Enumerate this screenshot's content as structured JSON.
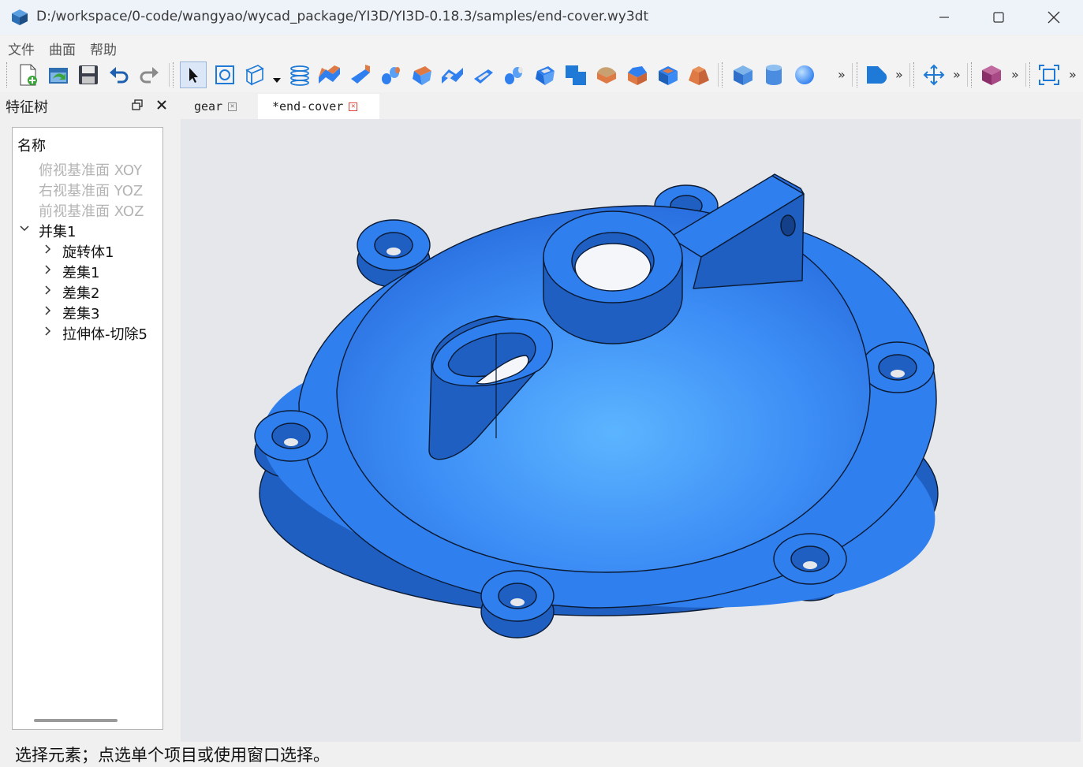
{
  "window": {
    "title": "D:/workspace/0-code/wangyao/wycad_package/YI3D/YI3D-0.18.3/samples/end-cover.wy3dt",
    "app_icon": "cube-app-icon",
    "controls": [
      "minimize-icon",
      "maximize-icon",
      "close-icon"
    ]
  },
  "menubar": {
    "items": [
      "文件",
      "曲面",
      "帮助"
    ]
  },
  "toolbar": {
    "more_glyph": "»",
    "groups": [
      [
        "new-document-icon",
        "open-document-icon",
        "save-icon",
        "undo-icon",
        "redo-icon"
      ],
      [
        "select-pointer-icon",
        "sketch-icon",
        "plane-icon",
        "dropdown-arrow-icon",
        "helix-icon",
        "extrude-icon",
        "revolve-icon",
        "sweep-icon",
        "loft-icon",
        "extrude-cut-icon",
        "revolve-cut-icon",
        "sweep-cut-icon",
        "loft-cut-icon",
        "boolean-icon",
        "fillet-icon",
        "chamfer-icon",
        "shell-icon",
        "draft-icon"
      ],
      [
        "box-icon",
        "cylinder-icon",
        "sphere-icon"
      ],
      [
        "shape-icon"
      ],
      [
        "move-icon"
      ],
      [
        "solid-icon"
      ],
      [
        "fit-view-icon"
      ]
    ]
  },
  "feature_tree": {
    "title": "特征树",
    "header": "名称",
    "planes": [
      "俯视基准面 XOY",
      "右视基准面 YOZ",
      "前视基准面 XOZ"
    ],
    "root": "并集1",
    "children": [
      "旋转体1",
      "差集1",
      "差集2",
      "差集3",
      "拉伸体-切除5"
    ]
  },
  "tabs": [
    {
      "label": "gear",
      "active": false
    },
    {
      "label": "*end-cover",
      "active": true
    }
  ],
  "colors": {
    "model_blue": "#2f7fef",
    "viewport_bg": "#e6e7ea",
    "tab_close_active": "#e0463f"
  },
  "status": {
    "text": "选择元素；点选单个项目或使用窗口选择。"
  }
}
